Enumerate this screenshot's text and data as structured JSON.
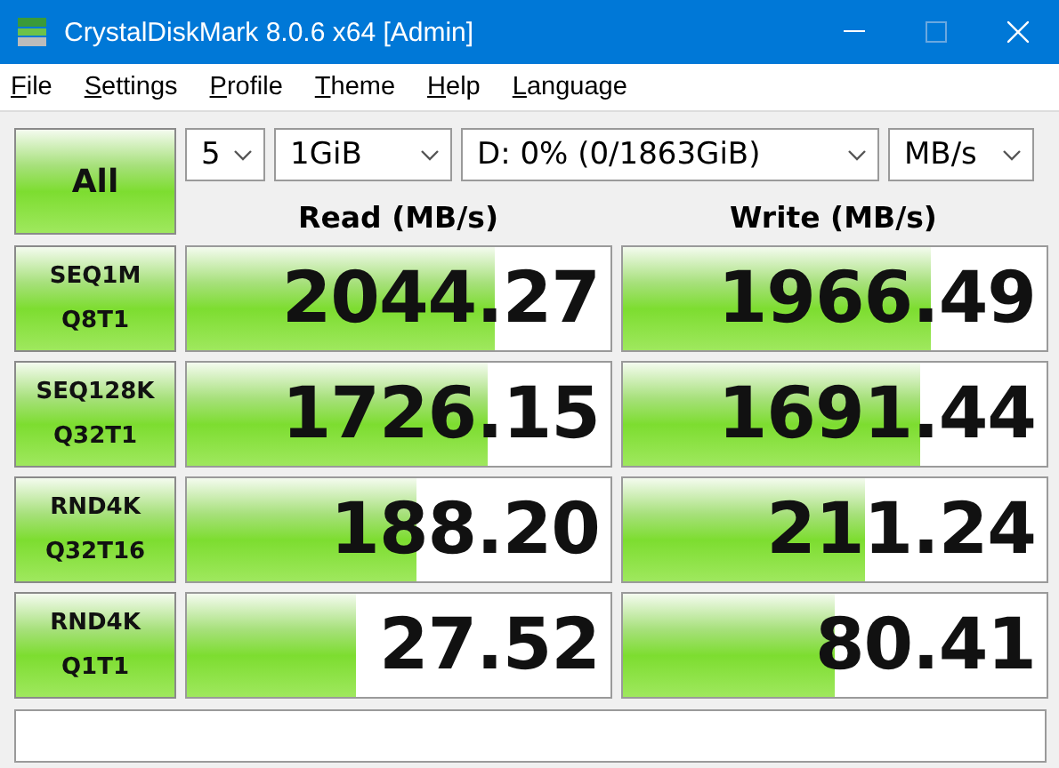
{
  "window": {
    "title": "CrystalDiskMark 8.0.6 x64 [Admin]"
  },
  "menu": [
    "File",
    "Settings",
    "Profile",
    "Theme",
    "Help",
    "Language"
  ],
  "all_button": "All",
  "selects": [
    {
      "value": "5"
    },
    {
      "value": "1GiB"
    },
    {
      "value": "D: 0% (0/1863GiB)"
    },
    {
      "value": "MB/s"
    }
  ],
  "columns": [
    "Read (MB/s)",
    "Write (MB/s)"
  ],
  "rows": [
    {
      "test": "SEQ1M",
      "params": "Q8T1",
      "read": {
        "value": "2044.27",
        "level": 0.725
      },
      "write": {
        "value": "1966.49",
        "level": 0.725
      }
    },
    {
      "test": "SEQ128K",
      "params": "Q32T1",
      "read": {
        "value": "1726.15",
        "level": 0.71
      },
      "write": {
        "value": "1691.44",
        "level": 0.7
      }
    },
    {
      "test": "RND4K",
      "params": "Q32T16",
      "read": {
        "value": "188.20",
        "level": 0.54
      },
      "write": {
        "value": "211.24",
        "level": 0.57
      }
    },
    {
      "test": "RND4K",
      "params": "Q1T1",
      "read": {
        "value": "27.52",
        "level": 0.4
      },
      "write": {
        "value": "80.41",
        "level": 0.5
      }
    }
  ]
}
